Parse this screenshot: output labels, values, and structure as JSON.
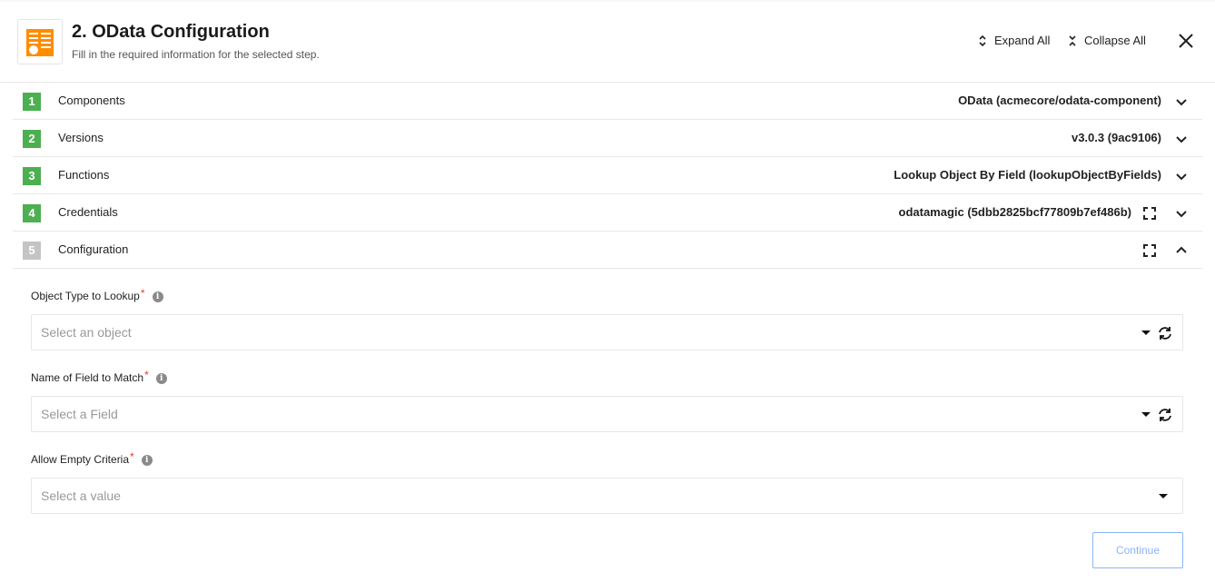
{
  "header": {
    "title": "2. OData Configuration",
    "subtitle": "Fill in the required information for the selected step.",
    "logo_icon": "form-list-icon",
    "logo_color": "#ff8c00",
    "expand_all_label": "Expand All",
    "collapse_all_label": "Collapse All",
    "close_icon": "close-icon"
  },
  "steps": [
    {
      "number": "1",
      "label": "Components",
      "value": "OData (acmecore/odata-component)",
      "status": "done",
      "expanded": false,
      "fullscreen": false
    },
    {
      "number": "2",
      "label": "Versions",
      "value": "v3.0.3 (9ac9106)",
      "status": "done",
      "expanded": false,
      "fullscreen": false
    },
    {
      "number": "3",
      "label": "Functions",
      "value": "Lookup Object By Field (lookupObjectByFields)",
      "status": "done",
      "expanded": false,
      "fullscreen": false
    },
    {
      "number": "4",
      "label": "Credentials",
      "value": "odatamagic (5dbb2825bcf77809b7ef486b)",
      "status": "done",
      "expanded": false,
      "fullscreen": true
    },
    {
      "number": "5",
      "label": "Configuration",
      "value": "",
      "status": "pending",
      "expanded": true,
      "fullscreen": true
    }
  ],
  "form": {
    "fields": [
      {
        "label": "Object Type to Lookup",
        "required": true,
        "required_mark": "*",
        "info": "i",
        "placeholder": "Select an object",
        "refresh": true
      },
      {
        "label": "Name of Field to Match",
        "required": true,
        "required_mark": "*",
        "info": "i",
        "placeholder": "Select a Field",
        "refresh": true
      },
      {
        "label": "Allow Empty Criteria",
        "required": true,
        "required_mark": "*",
        "info": "i",
        "placeholder": "Select a value",
        "refresh": false
      }
    ],
    "continue_label": "Continue"
  },
  "colors": {
    "step_done": "#4caf50",
    "step_pending": "#c4c4c4",
    "required": "#e53935",
    "continue_disabled": "#8ab4f8"
  }
}
